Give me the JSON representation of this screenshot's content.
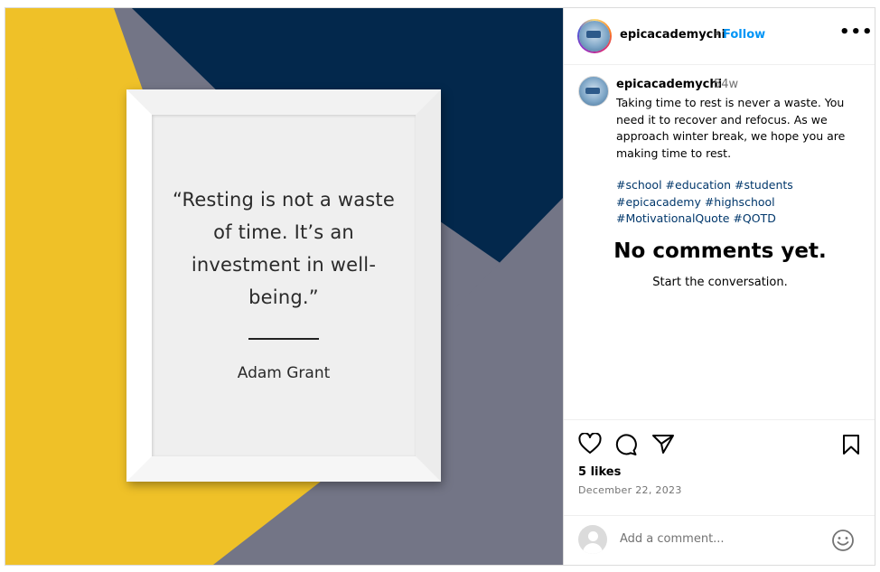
{
  "post": {
    "quote": "“Resting is not a waste of time. It’s an investment in well-being.”",
    "author": "Adam Grant",
    "colors": {
      "yellow": "#efc128",
      "navy": "#03284c",
      "gray": "#737586"
    }
  },
  "header": {
    "username": "epicacademychi",
    "separator": "•",
    "follow_label": "Follow",
    "more_label": "•••"
  },
  "caption": {
    "username": "epicacademychi",
    "age": "54w",
    "text": "Taking time to rest is never a waste. You need it to recover and refocus. As we approach winter break, we hope you are making time to rest.",
    "hashtags": [
      "#school",
      "#education",
      "#students",
      "#epicacademy",
      "#highschool",
      "#MotivationalQuote",
      "#QOTD"
    ]
  },
  "comments": {
    "empty_title": "No comments yet.",
    "empty_subtitle": "Start the conversation."
  },
  "actions": {
    "icons": [
      "heart-icon",
      "comment-icon",
      "share-icon",
      "bookmark-icon"
    ],
    "likes": "5 likes",
    "date": "December 22, 2023"
  },
  "comment_box": {
    "placeholder": "Add a comment..."
  }
}
